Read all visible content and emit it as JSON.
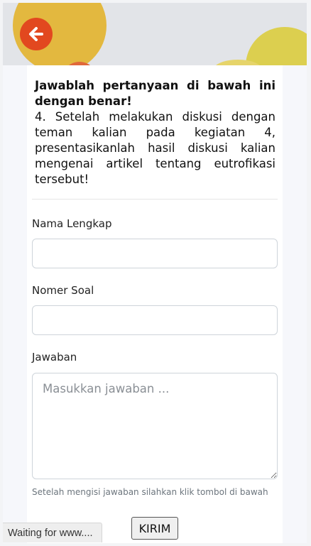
{
  "header": {
    "back_icon": "arrow-left-icon",
    "accent_color": "#e2481f"
  },
  "question": {
    "instruction": "Jawablah pertanyaan di bawah ini dengan benar!",
    "text": "4. Setelah melakukan diskusi dengan teman kalian pada kegiatan 4, presentasikanlah hasil diskusi kalian mengenai artikel tentang eutrofikasi tersebut!"
  },
  "form": {
    "name_label": "Nama Lengkap",
    "name_value": "",
    "number_label": "Nomer Soal",
    "number_value": "",
    "answer_label": "Jawaban",
    "answer_placeholder": "Masukkan jawaban ...",
    "hint": "Setelah mengisi jawaban silahkan klik tombol di bawah",
    "submit_label": "KIRIM"
  },
  "browser_status": "Waiting for www...."
}
